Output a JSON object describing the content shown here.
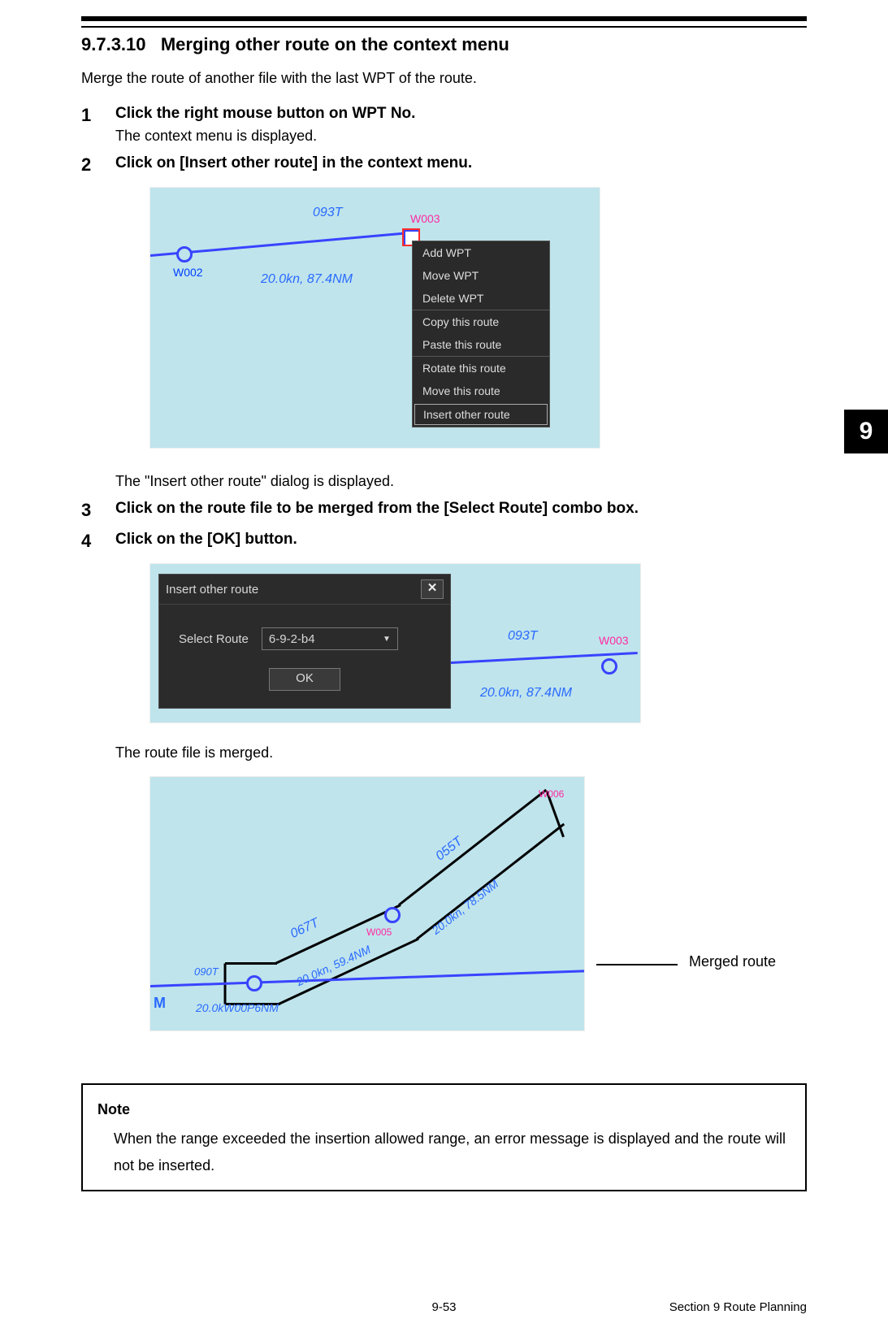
{
  "section": {
    "number": "9.7.3.10",
    "title": "Merging other route on the context menu"
  },
  "intro": "Merge the route of another file with the last WPT of the route.",
  "steps": {
    "s1": {
      "num": "1",
      "bold": "Click the right mouse button on WPT No.",
      "sub": "The context menu is displayed."
    },
    "s2": {
      "num": "2",
      "bold": "Click on [Insert other route] in the context menu."
    },
    "after2": "The \"Insert other route\" dialog is displayed.",
    "s3": {
      "num": "3",
      "bold": "Click on the route file to be merged from the [Select Route] combo box."
    },
    "s4": {
      "num": "4",
      "bold": "Click on the [OK] button."
    },
    "after4": "The route file is merged."
  },
  "shot1": {
    "w002": "W002",
    "w003": "W003",
    "bearing": "093T",
    "speed_dist": "20.0kn, 87.4NM",
    "menu": {
      "add": "Add WPT",
      "move": "Move WPT",
      "delete": "Delete WPT",
      "copy": "Copy this route",
      "paste": "Paste this route",
      "rotate": "Rotate this route",
      "mroute": "Move this route",
      "insert": "Insert other route"
    }
  },
  "shot2": {
    "dlg_title": "Insert other route",
    "label": "Select Route",
    "combo_value": "6-9-2-b4",
    "ok": "OK",
    "bearing": "093T",
    "w003": "W003",
    "speed_dist": "20.0kn, 87.4NM"
  },
  "shot3": {
    "callout": "Merged route",
    "b055": "055T",
    "b067": "067T",
    "b090": "090T",
    "speed2": "20.0kn, 59.4NM",
    "speed3": "20.0kn, 78.5NM",
    "bottom": "20.0kW00P6NM",
    "M": "M",
    "w005": "W005",
    "w006": "W006"
  },
  "note": {
    "head": "Note",
    "body": "When the range exceeded the insertion allowed range, an error message is displayed and the route will not be inserted."
  },
  "side_tab": "9",
  "footer": {
    "page": "9-53",
    "section": "Section 9    Route Planning"
  }
}
